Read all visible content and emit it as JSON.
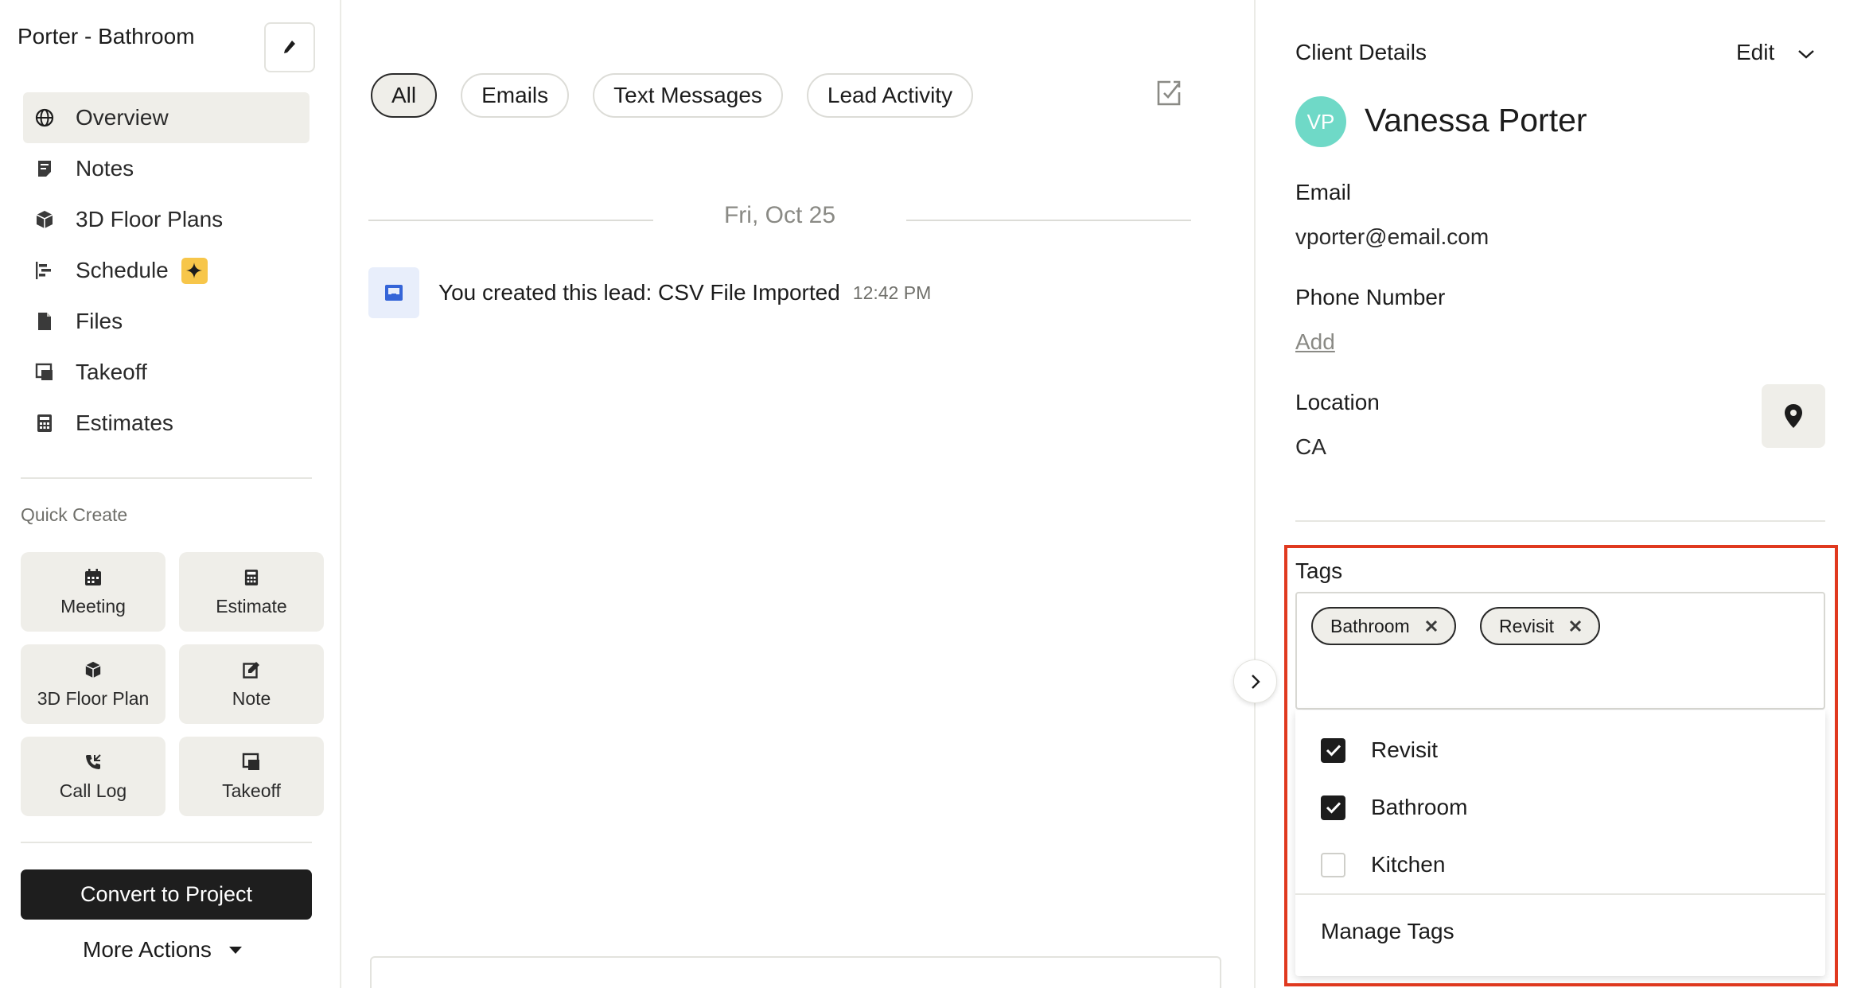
{
  "sidebar": {
    "project_title": "Porter - Bathroom",
    "nav": [
      {
        "label": "Overview",
        "icon": "globe-icon",
        "active": true
      },
      {
        "label": "Notes",
        "icon": "notes-icon"
      },
      {
        "label": "3D Floor Plans",
        "icon": "cube-icon"
      },
      {
        "label": "Schedule",
        "icon": "schedule-icon",
        "badge_icon": "sparkle-icon"
      },
      {
        "label": "Files",
        "icon": "file-icon"
      },
      {
        "label": "Takeoff",
        "icon": "takeoff-icon"
      },
      {
        "label": "Estimates",
        "icon": "calculator-icon"
      }
    ],
    "quick_create_label": "Quick Create",
    "quick_create": [
      {
        "label": "Meeting",
        "icon": "calendar-icon"
      },
      {
        "label": "Estimate",
        "icon": "calculator-icon"
      },
      {
        "label": "3D Floor Plan",
        "icon": "cube-icon"
      },
      {
        "label": "Note",
        "icon": "edit-note-icon"
      },
      {
        "label": "Call Log",
        "icon": "phone-icon"
      },
      {
        "label": "Takeoff",
        "icon": "takeoff-icon"
      }
    ],
    "convert_button": "Convert to Project",
    "more_actions": "More Actions"
  },
  "main": {
    "filters": [
      "All",
      "Emails",
      "Text Messages",
      "Lead Activity"
    ],
    "active_filter": "All",
    "date_separator": "Fri, Oct 25",
    "activity": {
      "text": "You created this lead: CSV File Imported",
      "time": "12:42 PM",
      "icon": "inbox-icon"
    }
  },
  "client": {
    "title": "Client Details",
    "edit_label": "Edit",
    "avatar_initials": "VP",
    "avatar_color": "#6fd9c7",
    "name": "Vanessa Porter",
    "email_label": "Email",
    "email": "vporter@email.com",
    "phone_label": "Phone Number",
    "phone_add": "Add",
    "location_label": "Location",
    "location": "CA"
  },
  "tags": {
    "label": "Tags",
    "selected": [
      "Bathroom",
      "Revisit"
    ],
    "options": [
      {
        "label": "Revisit",
        "checked": true
      },
      {
        "label": "Bathroom",
        "checked": true
      },
      {
        "label": "Kitchen",
        "checked": false
      }
    ],
    "manage_label": "Manage Tags",
    "highlight_color": "#e0391f"
  }
}
